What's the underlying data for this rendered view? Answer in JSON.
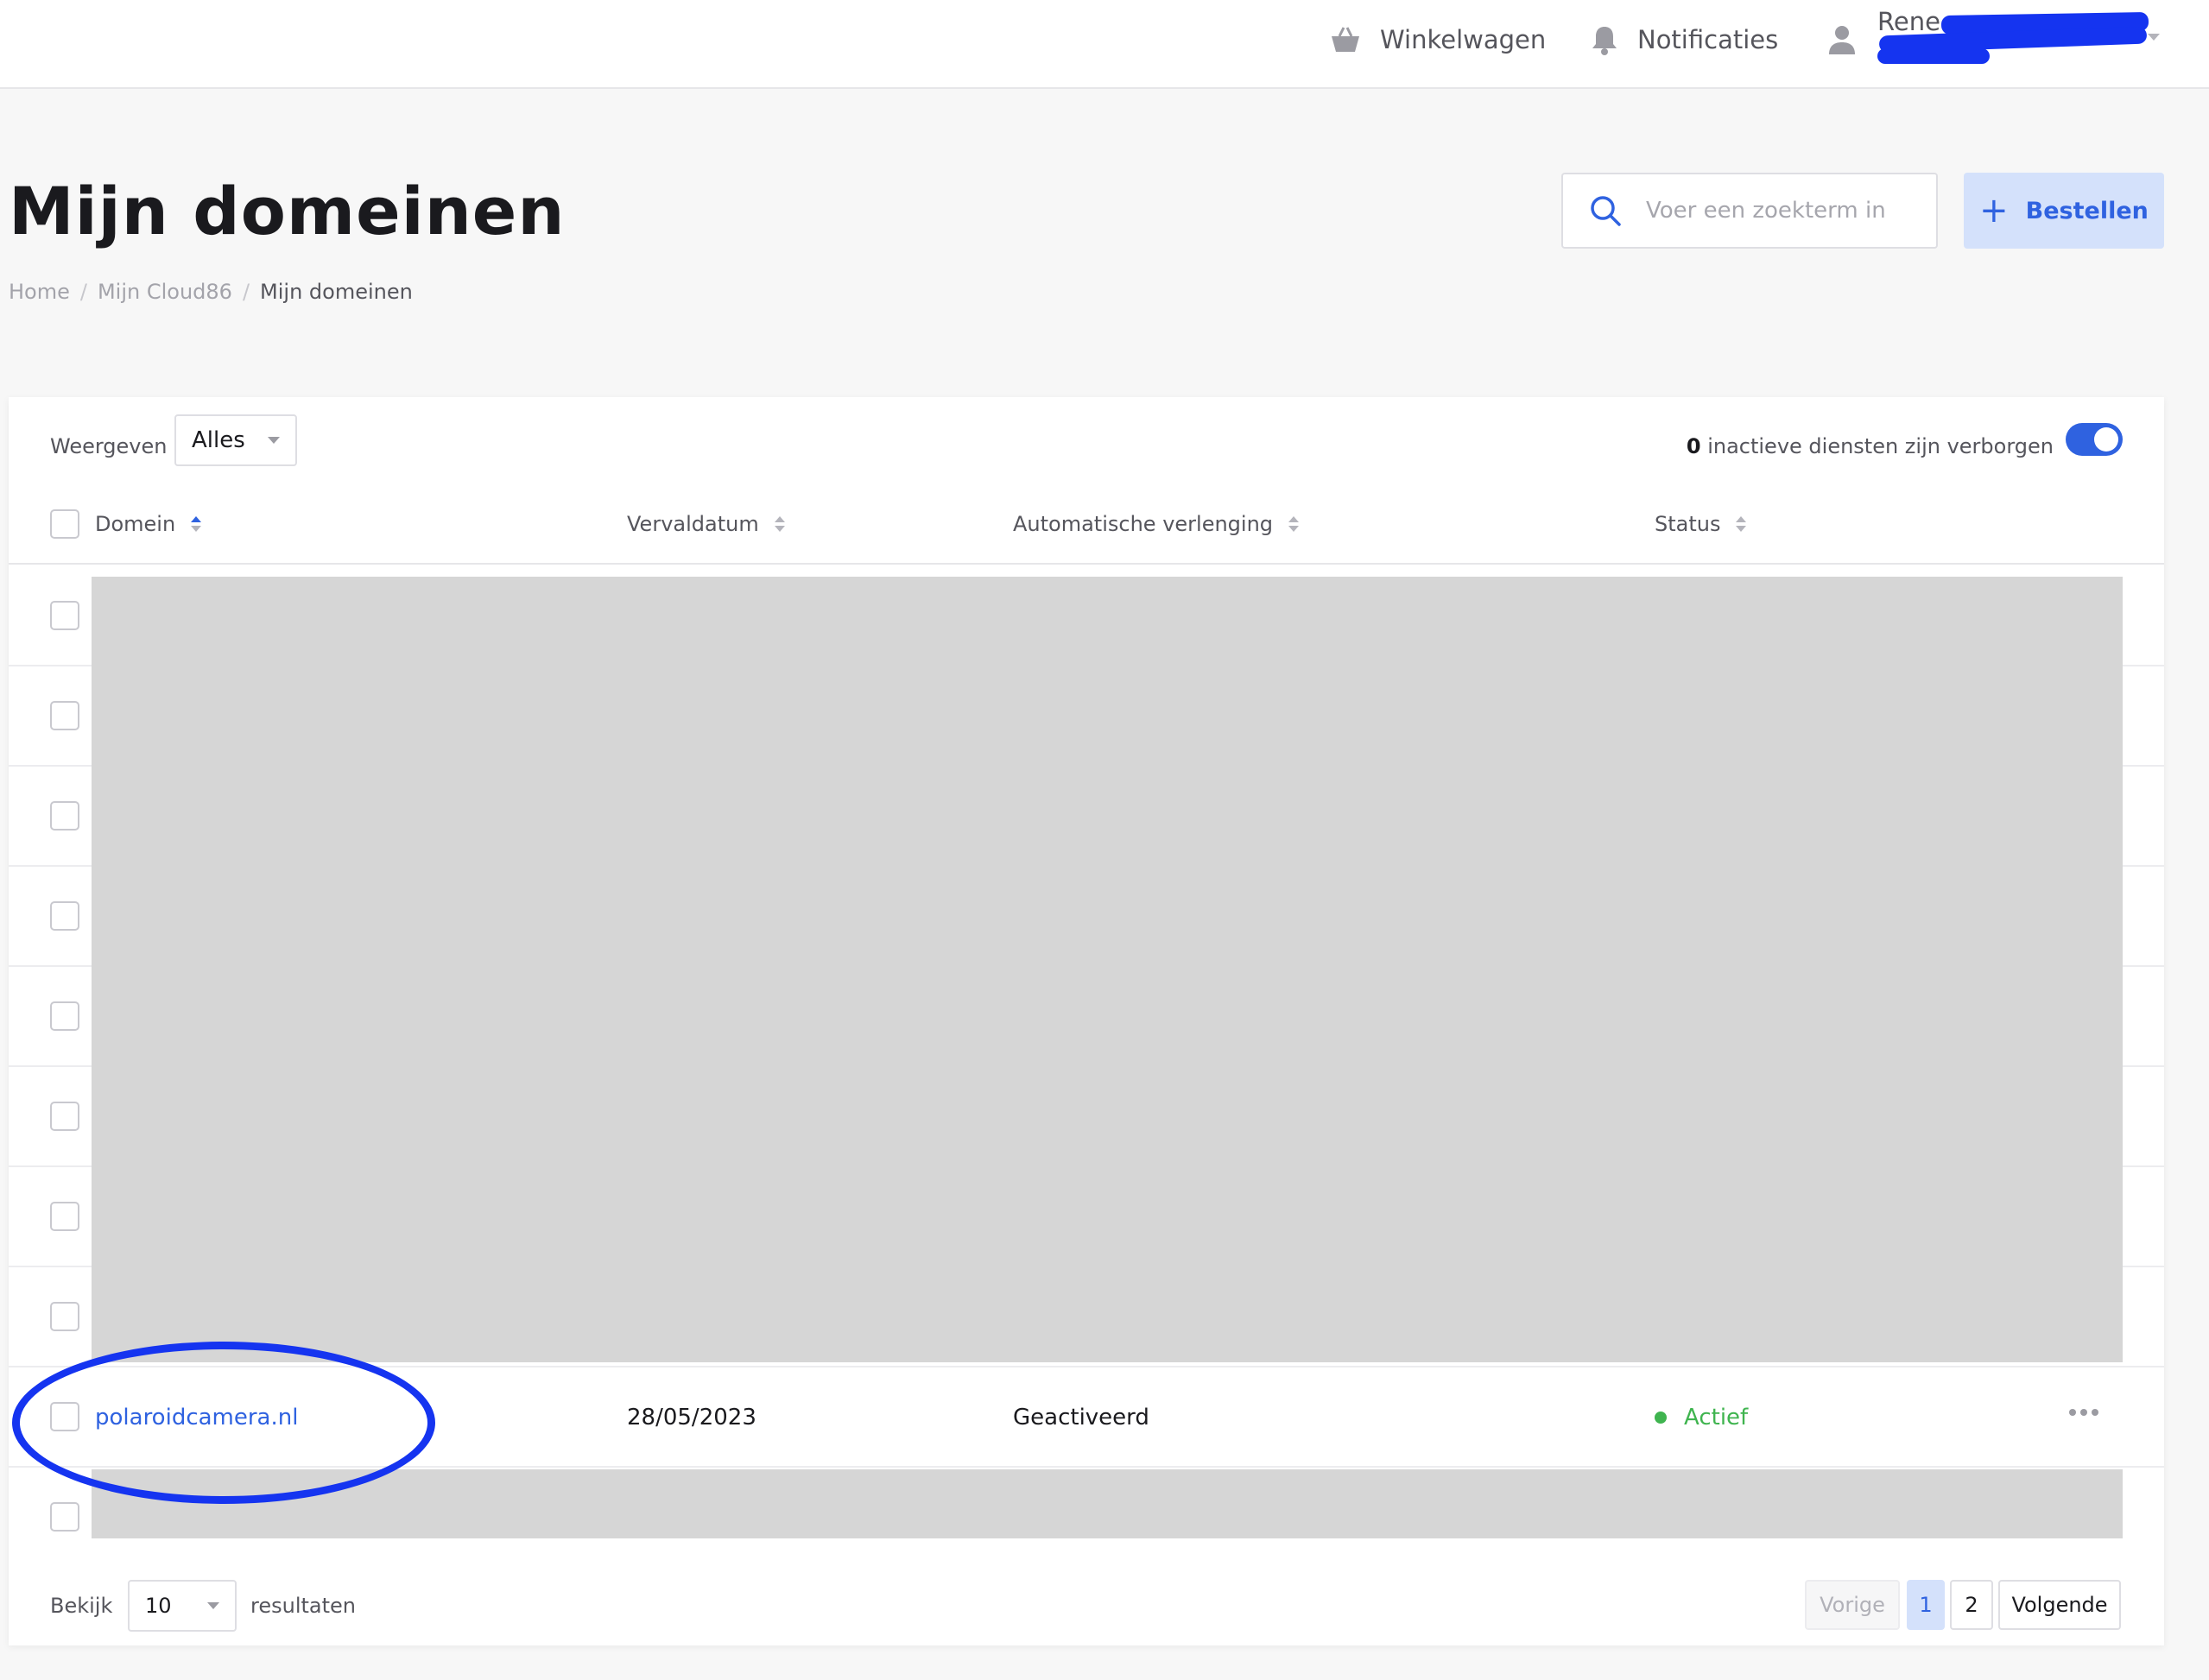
{
  "topbar": {
    "cart_label": "Winkelwagen",
    "notifications_label": "Notificaties",
    "user_name": "Rene"
  },
  "header": {
    "title": "Mijn domeinen",
    "breadcrumb": [
      "Home",
      "Mijn Cloud86",
      "Mijn domeinen"
    ],
    "search_placeholder": "Voer een zoekterm in",
    "order_label": "Bestellen"
  },
  "filters": {
    "show_label": "Weergeven",
    "show_value": "Alles",
    "inactive_count": "0",
    "inactive_text": "inactieve diensten zijn verborgen"
  },
  "table": {
    "columns": [
      "Domein",
      "Vervaldatum",
      "Automatische verlenging",
      "Status"
    ],
    "visible_row": {
      "domain": "polaroidcamera.nl",
      "expiry": "28/05/2023",
      "renewal": "Geactiveerd",
      "status": "Actief"
    }
  },
  "footer": {
    "view_label": "Bekijk",
    "page_size": "10",
    "results_label": "resultaten",
    "prev_label": "Vorige",
    "pages": [
      "1",
      "2"
    ],
    "next_label": "Volgende"
  },
  "colors": {
    "accent": "#2f62e0",
    "status_active": "#3fb44f",
    "redaction_mark": "#1534f0",
    "redaction_block": "#d6d6d6"
  }
}
